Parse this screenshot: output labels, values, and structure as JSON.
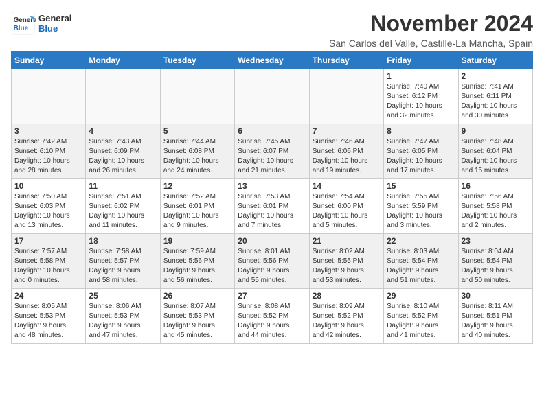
{
  "header": {
    "logo_line1": "General",
    "logo_line2": "Blue",
    "month": "November 2024",
    "location": "San Carlos del Valle, Castille-La Mancha, Spain"
  },
  "weekdays": [
    "Sunday",
    "Monday",
    "Tuesday",
    "Wednesday",
    "Thursday",
    "Friday",
    "Saturday"
  ],
  "weeks": [
    [
      {
        "day": "",
        "info": ""
      },
      {
        "day": "",
        "info": ""
      },
      {
        "day": "",
        "info": ""
      },
      {
        "day": "",
        "info": ""
      },
      {
        "day": "",
        "info": ""
      },
      {
        "day": "1",
        "info": "Sunrise: 7:40 AM\nSunset: 6:12 PM\nDaylight: 10 hours\nand 32 minutes."
      },
      {
        "day": "2",
        "info": "Sunrise: 7:41 AM\nSunset: 6:11 PM\nDaylight: 10 hours\nand 30 minutes."
      }
    ],
    [
      {
        "day": "3",
        "info": "Sunrise: 7:42 AM\nSunset: 6:10 PM\nDaylight: 10 hours\nand 28 minutes."
      },
      {
        "day": "4",
        "info": "Sunrise: 7:43 AM\nSunset: 6:09 PM\nDaylight: 10 hours\nand 26 minutes."
      },
      {
        "day": "5",
        "info": "Sunrise: 7:44 AM\nSunset: 6:08 PM\nDaylight: 10 hours\nand 24 minutes."
      },
      {
        "day": "6",
        "info": "Sunrise: 7:45 AM\nSunset: 6:07 PM\nDaylight: 10 hours\nand 21 minutes."
      },
      {
        "day": "7",
        "info": "Sunrise: 7:46 AM\nSunset: 6:06 PM\nDaylight: 10 hours\nand 19 minutes."
      },
      {
        "day": "8",
        "info": "Sunrise: 7:47 AM\nSunset: 6:05 PM\nDaylight: 10 hours\nand 17 minutes."
      },
      {
        "day": "9",
        "info": "Sunrise: 7:48 AM\nSunset: 6:04 PM\nDaylight: 10 hours\nand 15 minutes."
      }
    ],
    [
      {
        "day": "10",
        "info": "Sunrise: 7:50 AM\nSunset: 6:03 PM\nDaylight: 10 hours\nand 13 minutes."
      },
      {
        "day": "11",
        "info": "Sunrise: 7:51 AM\nSunset: 6:02 PM\nDaylight: 10 hours\nand 11 minutes."
      },
      {
        "day": "12",
        "info": "Sunrise: 7:52 AM\nSunset: 6:01 PM\nDaylight: 10 hours\nand 9 minutes."
      },
      {
        "day": "13",
        "info": "Sunrise: 7:53 AM\nSunset: 6:01 PM\nDaylight: 10 hours\nand 7 minutes."
      },
      {
        "day": "14",
        "info": "Sunrise: 7:54 AM\nSunset: 6:00 PM\nDaylight: 10 hours\nand 5 minutes."
      },
      {
        "day": "15",
        "info": "Sunrise: 7:55 AM\nSunset: 5:59 PM\nDaylight: 10 hours\nand 3 minutes."
      },
      {
        "day": "16",
        "info": "Sunrise: 7:56 AM\nSunset: 5:58 PM\nDaylight: 10 hours\nand 2 minutes."
      }
    ],
    [
      {
        "day": "17",
        "info": "Sunrise: 7:57 AM\nSunset: 5:58 PM\nDaylight: 10 hours\nand 0 minutes."
      },
      {
        "day": "18",
        "info": "Sunrise: 7:58 AM\nSunset: 5:57 PM\nDaylight: 9 hours\nand 58 minutes."
      },
      {
        "day": "19",
        "info": "Sunrise: 7:59 AM\nSunset: 5:56 PM\nDaylight: 9 hours\nand 56 minutes."
      },
      {
        "day": "20",
        "info": "Sunrise: 8:01 AM\nSunset: 5:56 PM\nDaylight: 9 hours\nand 55 minutes."
      },
      {
        "day": "21",
        "info": "Sunrise: 8:02 AM\nSunset: 5:55 PM\nDaylight: 9 hours\nand 53 minutes."
      },
      {
        "day": "22",
        "info": "Sunrise: 8:03 AM\nSunset: 5:54 PM\nDaylight: 9 hours\nand 51 minutes."
      },
      {
        "day": "23",
        "info": "Sunrise: 8:04 AM\nSunset: 5:54 PM\nDaylight: 9 hours\nand 50 minutes."
      }
    ],
    [
      {
        "day": "24",
        "info": "Sunrise: 8:05 AM\nSunset: 5:53 PM\nDaylight: 9 hours\nand 48 minutes."
      },
      {
        "day": "25",
        "info": "Sunrise: 8:06 AM\nSunset: 5:53 PM\nDaylight: 9 hours\nand 47 minutes."
      },
      {
        "day": "26",
        "info": "Sunrise: 8:07 AM\nSunset: 5:53 PM\nDaylight: 9 hours\nand 45 minutes."
      },
      {
        "day": "27",
        "info": "Sunrise: 8:08 AM\nSunset: 5:52 PM\nDaylight: 9 hours\nand 44 minutes."
      },
      {
        "day": "28",
        "info": "Sunrise: 8:09 AM\nSunset: 5:52 PM\nDaylight: 9 hours\nand 42 minutes."
      },
      {
        "day": "29",
        "info": "Sunrise: 8:10 AM\nSunset: 5:52 PM\nDaylight: 9 hours\nand 41 minutes."
      },
      {
        "day": "30",
        "info": "Sunrise: 8:11 AM\nSunset: 5:51 PM\nDaylight: 9 hours\nand 40 minutes."
      }
    ]
  ]
}
